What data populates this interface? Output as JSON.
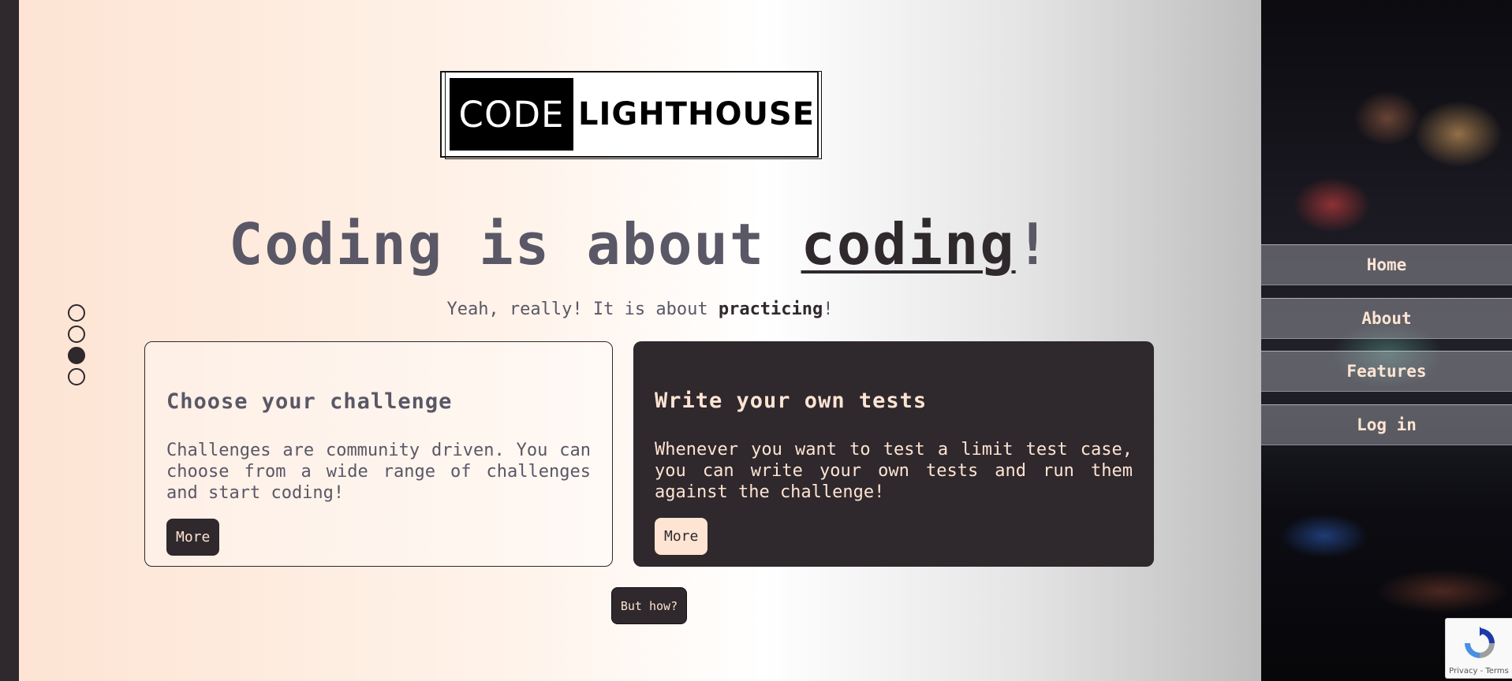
{
  "logo": {
    "part1": "CODE",
    "part2": "LIGHTHOUSE"
  },
  "headline": {
    "text_before": "Coding is about ",
    "emphasis": "coding",
    "suffix": "!"
  },
  "subline": {
    "before": "Yeah, really! It is about ",
    "bold": "practicing",
    "after": "!"
  },
  "carousel_dots": {
    "count": 4,
    "active_index": 2
  },
  "cards": [
    {
      "title": "Choose your challenge",
      "description": "Challenges are community driven. You can choose from a wide range of challenges and start coding!",
      "button": "More"
    },
    {
      "title": "Write your own tests",
      "description": "Whenever you want to test a limit test case, you can write your own tests and run them against the challenge!",
      "button": "More"
    }
  ],
  "how_button": "But how?",
  "nav": {
    "items": [
      {
        "label": "Home"
      },
      {
        "label": "About"
      },
      {
        "label": "Features"
      },
      {
        "label": "Log in"
      }
    ]
  },
  "recaptcha": {
    "privacy": "Privacy",
    "sep": " - ",
    "terms": "Terms"
  },
  "colors": {
    "dark": "#2f282c",
    "cream": "#fde4d3",
    "text_muted": "#5a5766"
  }
}
